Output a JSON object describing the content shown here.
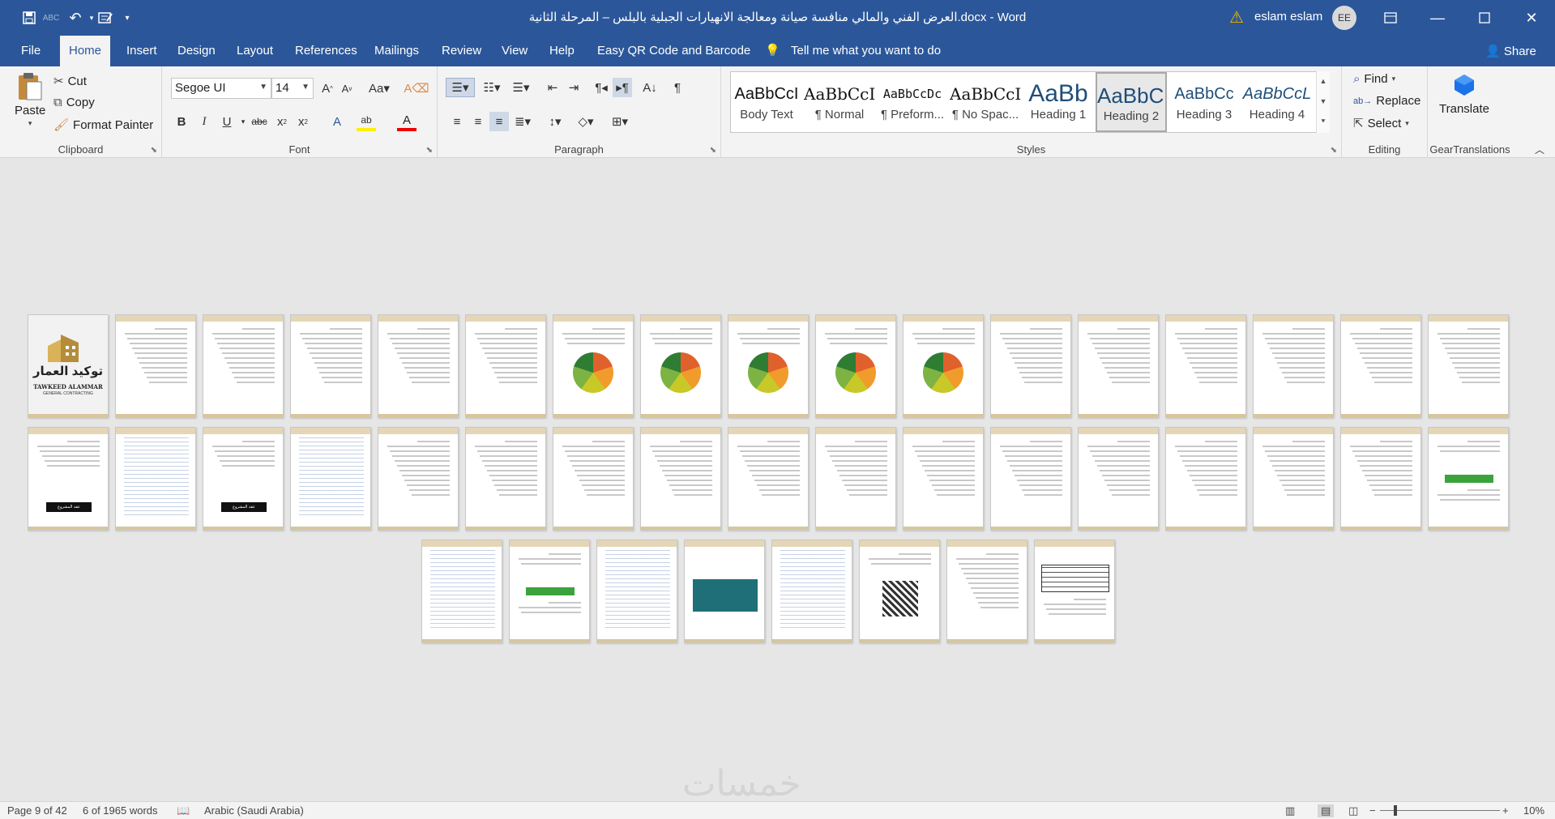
{
  "window": {
    "title": "العرض الفني والمالي   منافسة صيانة ومعالجة الانهيارات الجبلية بالبلس – المرحلة الثانية.docx  -  Word",
    "user_name": "eslam eslam",
    "user_initials": "EE"
  },
  "quick_access": {
    "save_icon": "save-icon",
    "spelling_icon": "spelling-check-icon",
    "undo_icon": "undo-icon",
    "customize_icon": "customize-icon"
  },
  "tabs": [
    "File",
    "Home",
    "Insert",
    "Design",
    "Layout",
    "References",
    "Mailings",
    "Review",
    "View",
    "Help",
    "Easy QR Code and Barcode"
  ],
  "active_tab": "Home",
  "tell_me": "Tell me what you want to do",
  "share_label": "Share",
  "ribbon": {
    "clipboard": {
      "label": "Clipboard",
      "paste": "Paste",
      "cut": "Cut",
      "copy": "Copy",
      "format_painter": "Format Painter"
    },
    "font": {
      "label": "Font",
      "font_name": "Segoe UI",
      "font_size": "14"
    },
    "paragraph": {
      "label": "Paragraph"
    },
    "styles": {
      "label": "Styles",
      "items": [
        {
          "preview": "AaBbCcI",
          "name": "Body Text"
        },
        {
          "preview": "AaBbCcI",
          "name": "¶ Normal"
        },
        {
          "preview": "AaBbCcDc",
          "name": "¶ Preform..."
        },
        {
          "preview": "AaBbCcI",
          "name": "¶ No Spac..."
        },
        {
          "preview": "AaBb",
          "name": "Heading 1"
        },
        {
          "preview": "AaBbC(",
          "name": "Heading 2"
        },
        {
          "preview": "AaBbCc",
          "name": "Heading 3"
        },
        {
          "preview": "AaBbCcL",
          "name": "Heading 4"
        }
      ],
      "selected": "Heading 2"
    },
    "editing": {
      "label": "Editing",
      "find": "Find",
      "replace": "Replace",
      "select": "Select"
    },
    "gear": {
      "label": "GearTranslations",
      "translate": "Translate"
    }
  },
  "document": {
    "cover_logo_text_ar": "توكيد العمار",
    "cover_logo_text_en": "TAWKEED ALAMMAR",
    "cover_logo_sub": "GENERAL CONTRACTING",
    "watermark": "خمسات",
    "thumbnail_label": "عقد المشروع"
  },
  "status": {
    "page": "Page 9 of 42",
    "words": "6 of 1965 words",
    "language": "Arabic (Saudi Arabia)",
    "zoom": "10%"
  },
  "colors": {
    "titlebar": "#2b579a",
    "ribbon_bg": "#f3f3f3",
    "page_header": "#e4d6b6",
    "warning": "#f5b400"
  }
}
